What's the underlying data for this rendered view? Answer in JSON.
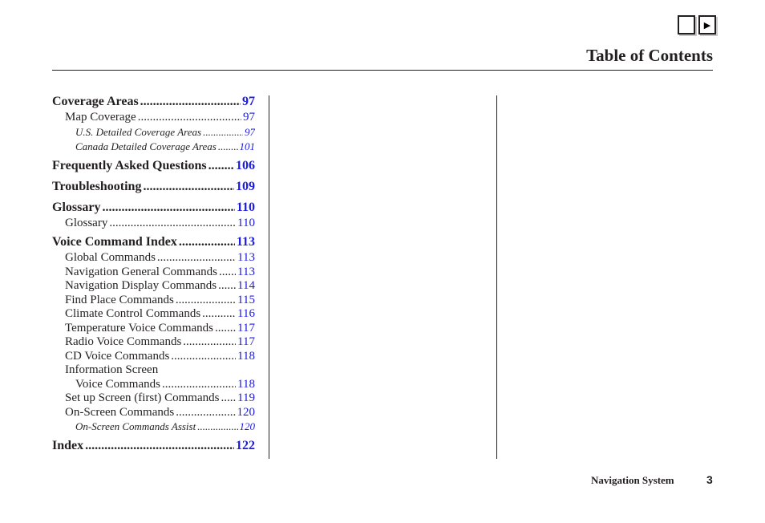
{
  "nav_buttons": {
    "prev_label": "",
    "next_label": "▶"
  },
  "header": {
    "title": "Table of Contents"
  },
  "toc": [
    {
      "level": 1,
      "label": "Coverage Areas",
      "page": "97"
    },
    {
      "level": 2,
      "label": "Map Coverage",
      "page": "97"
    },
    {
      "level": 3,
      "label": "U.S. Detailed Coverage Areas",
      "page": "97"
    },
    {
      "level": 3,
      "label": "Canada Detailed Coverage Areas",
      "page": "101"
    },
    {
      "level": 1,
      "label": "Frequently Asked Questions",
      "page": "106"
    },
    {
      "level": 1,
      "label": "Troubleshooting",
      "page": "109"
    },
    {
      "level": 1,
      "label": "Glossary",
      "page": "110"
    },
    {
      "level": 2,
      "label": "Glossary",
      "page": "110"
    },
    {
      "level": 1,
      "label": "Voice Command Index",
      "page": "113"
    },
    {
      "level": 2,
      "label": "Global Commands",
      "page": "113"
    },
    {
      "level": 2,
      "label": "Navigation General Commands",
      "page": "113"
    },
    {
      "level": 2,
      "label": "Navigation Display Commands",
      "page": "114"
    },
    {
      "level": 2,
      "label": "Find Place Commands",
      "page": "115"
    },
    {
      "level": 2,
      "label": "Climate Control Commands",
      "page": "116"
    },
    {
      "level": 2,
      "label": "Temperature Voice Commands",
      "page": "117"
    },
    {
      "level": 2,
      "label": "Radio Voice Commands",
      "page": "117"
    },
    {
      "level": 2,
      "label": "CD Voice Commands",
      "page": "118"
    },
    {
      "level": 2,
      "label": "Information Screen",
      "page": ""
    },
    {
      "level": 2,
      "label": "Voice Commands",
      "page": "118",
      "continuation": true
    },
    {
      "level": 2,
      "label": "Set up Screen (first) Commands",
      "page": "119"
    },
    {
      "level": 2,
      "label": "On-Screen Commands",
      "page": "120"
    },
    {
      "level": 3,
      "label": "On-Screen Commands Assist",
      "page": "120"
    },
    {
      "level": 1,
      "label": "Index",
      "page": "122"
    }
  ],
  "footer": {
    "section": "Navigation System",
    "page_number": "3"
  }
}
